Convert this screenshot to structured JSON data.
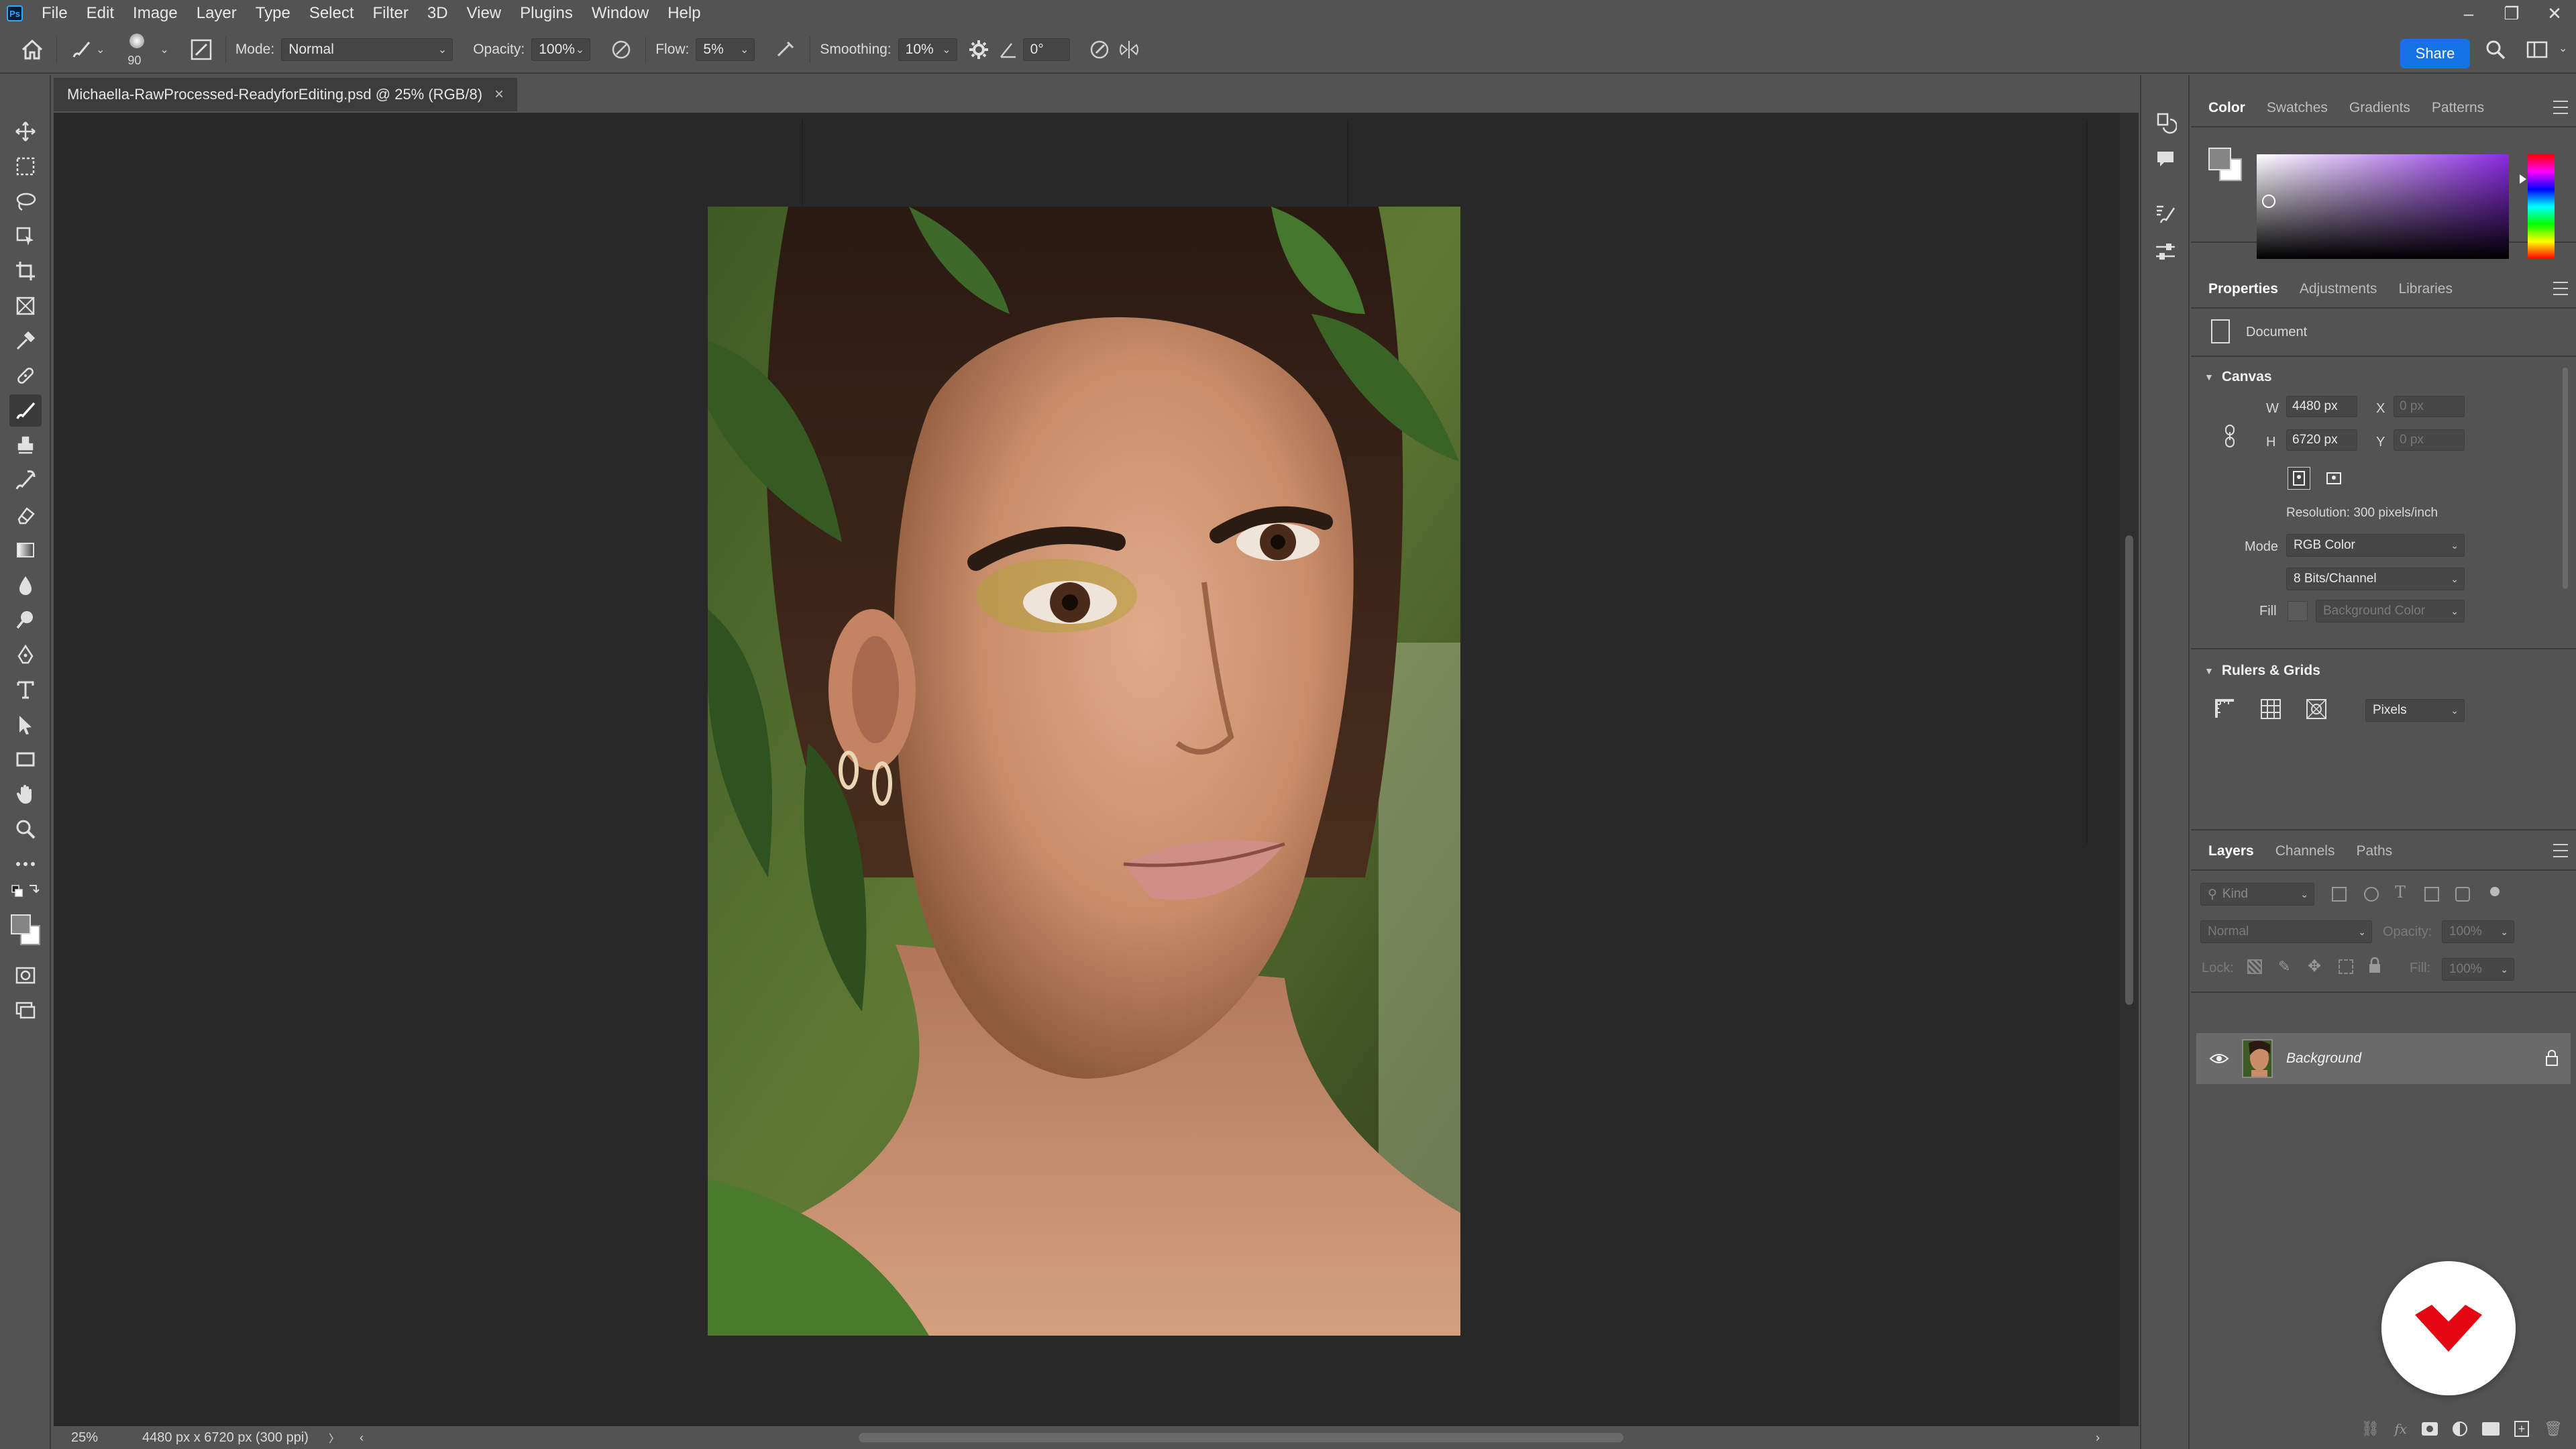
{
  "app": {
    "logo_text": "Ps",
    "menu": [
      "File",
      "Edit",
      "Image",
      "Layer",
      "Type",
      "Select",
      "Filter",
      "3D",
      "View",
      "Plugins",
      "Window",
      "Help"
    ],
    "window_controls": {
      "minimize": "–",
      "restore": "❐",
      "close": "✕"
    }
  },
  "options": {
    "brush_size": "90",
    "mode_label": "Mode:",
    "mode_value": "Normal",
    "opacity_label": "Opacity:",
    "opacity_value": "100%",
    "flow_label": "Flow:",
    "flow_value": "5%",
    "smoothing_label": "Smoothing:",
    "smoothing_value": "10%",
    "angle_value": "0°",
    "share_label": "Share"
  },
  "document": {
    "tab_title": "Michaella-RawProcessed-ReadyforEditing.psd @ 25% (RGB/8)",
    "tab_close": "×"
  },
  "status": {
    "zoom": "25%",
    "doc_info": "4480 px x 6720 px (300 ppi)",
    "arrow": "〉"
  },
  "color_panel": {
    "tabs": [
      "Color",
      "Swatches",
      "Gradients",
      "Patterns"
    ],
    "active_tab": "Color"
  },
  "properties_panel": {
    "tabs": [
      "Properties",
      "Adjustments",
      "Libraries"
    ],
    "doc_label": "Document",
    "canvas_title": "Canvas",
    "w_label": "W",
    "w_value": "4480 px",
    "h_label": "H",
    "h_value": "6720 px",
    "x_label": "X",
    "x_placeholder": "0 px",
    "y_label": "Y",
    "y_placeholder": "0 px",
    "resolution": "Resolution: 300 pixels/inch",
    "mode_label": "Mode",
    "mode_value": "RGB Color",
    "bits_value": "8 Bits/Channel",
    "fill_label": "Fill",
    "fill_value": "Background Color",
    "rulers_title": "Rulers & Grids",
    "units_value": "Pixels"
  },
  "layers_panel": {
    "tabs": [
      "Layers",
      "Channels",
      "Paths"
    ],
    "kind_placeholder": "Kind",
    "blend_value": "Normal",
    "opacity_label": "Opacity:",
    "opacity_value": "100%",
    "lock_label": "Lock:",
    "fill_label": "Fill:",
    "fill_value": "100%",
    "layers": [
      {
        "name": "Background",
        "visible": true,
        "locked": true
      }
    ]
  },
  "colors": {
    "accent": "#1473e6",
    "panel_bg": "#535353",
    "canvas_bg": "#282828",
    "watermark": "#e30613"
  }
}
